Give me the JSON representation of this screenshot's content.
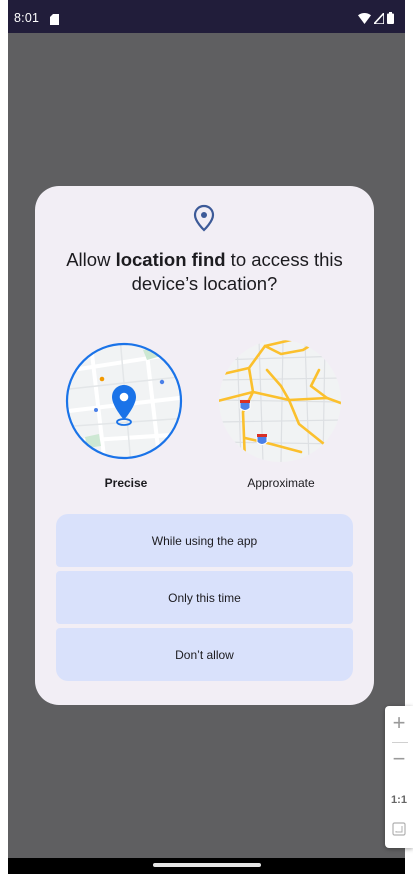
{
  "status_bar": {
    "time": "8:01",
    "icons": [
      "sim-card-icon",
      "wifi-icon",
      "cellular-signal-icon",
      "battery-icon"
    ]
  },
  "dialog": {
    "icon": "location-pin-icon",
    "title_prefix": "Allow ",
    "app_name": "location find",
    "title_suffix": " to access this device’s location?",
    "options": {
      "precise_label": "Precise",
      "approximate_label": "Approximate",
      "selected": "precise"
    },
    "buttons": [
      {
        "label": "While using the app"
      },
      {
        "label": "Only this time"
      },
      {
        "label": "Don’t allow"
      }
    ]
  },
  "zoom_controls": {
    "reset_label": "1:1",
    "icons": [
      "zoom-in-icon",
      "zoom-out-icon",
      "fit-screen-icon"
    ]
  },
  "colors": {
    "accent_blue": "#1a73e8",
    "dialog_bg": "#f2eef5",
    "button_bg": "#d9e1fb",
    "status_bar_bg": "#211d3a",
    "scrim": "#5f5f61"
  }
}
